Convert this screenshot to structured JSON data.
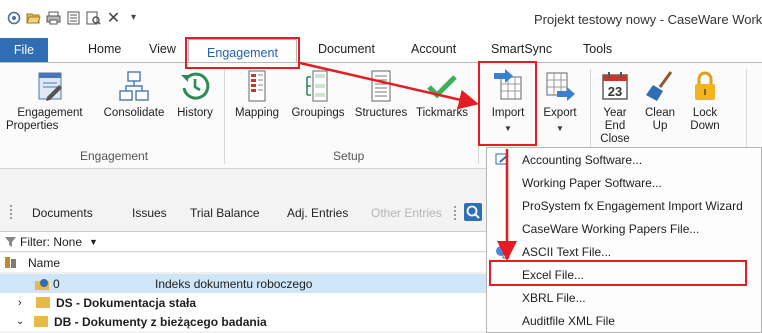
{
  "window": {
    "title": "Projekt testowy nowy - CaseWare Work"
  },
  "quick_access": [
    "app-icon",
    "open-icon",
    "print-icon",
    "checklist-icon",
    "preview-icon",
    "close-icon",
    "qat-dropdown-icon"
  ],
  "tabs": [
    {
      "label": "File"
    },
    {
      "label": "Home"
    },
    {
      "label": "View"
    },
    {
      "label": "Engagement"
    },
    {
      "label": "Document"
    },
    {
      "label": "Account"
    },
    {
      "label": "SmartSync"
    },
    {
      "label": "Tools"
    }
  ],
  "ribbon": {
    "groups": [
      {
        "label": "Engagement"
      },
      {
        "label": "Setup"
      }
    ],
    "buttons": {
      "engagement_properties": [
        "Engagement",
        "Properties"
      ],
      "consolidate": "Consolidate",
      "history": "History",
      "mapping": "Mapping",
      "groupings": "Groupings",
      "structures": "Structures",
      "tickmarks": "Tickmarks",
      "import": "Import",
      "export": "Export",
      "year_end_close": [
        "Year End",
        "Close"
      ],
      "clean_up": [
        "Clean",
        "Up"
      ],
      "lock_down": [
        "Lock",
        "Down"
      ]
    }
  },
  "doc_tabs": [
    {
      "label": "Documents",
      "enabled": true
    },
    {
      "label": "Issues",
      "enabled": true
    },
    {
      "label": "Trial Balance",
      "enabled": true
    },
    {
      "label": "Adj. Entries",
      "enabled": true
    },
    {
      "label": "Other Entries",
      "enabled": false
    }
  ],
  "filter": {
    "label": "Filter: None"
  },
  "tree": {
    "header": "Name",
    "rows": [
      {
        "code": "0",
        "label": "Indeks dokumentu roboczego",
        "selected": true
      },
      {
        "code": "DS - Dokumentacja stała",
        "label": "",
        "selected": false
      },
      {
        "code": "DB - Dokumenty z bieżącego badania",
        "label": "",
        "selected": false
      }
    ]
  },
  "import_menu": {
    "items": [
      {
        "label": "Accounting Software...",
        "icon": "accounting-icon"
      },
      {
        "label": "Working Paper Software...",
        "icon": ""
      },
      {
        "label": "ProSystem fx Engagement Import Wizard",
        "icon": ""
      },
      {
        "label": "CaseWare Working Papers File...",
        "icon": ""
      },
      {
        "label": "ASCII Text File...",
        "icon": "ascii-icon"
      },
      {
        "label": "Excel File...",
        "icon": ""
      },
      {
        "label": "XBRL File...",
        "icon": ""
      },
      {
        "label": "Auditfile XML File",
        "icon": ""
      }
    ]
  },
  "colors": {
    "accent": "#2f6db5",
    "annotation": "#e41d22",
    "selection": "#cfe6f8"
  }
}
